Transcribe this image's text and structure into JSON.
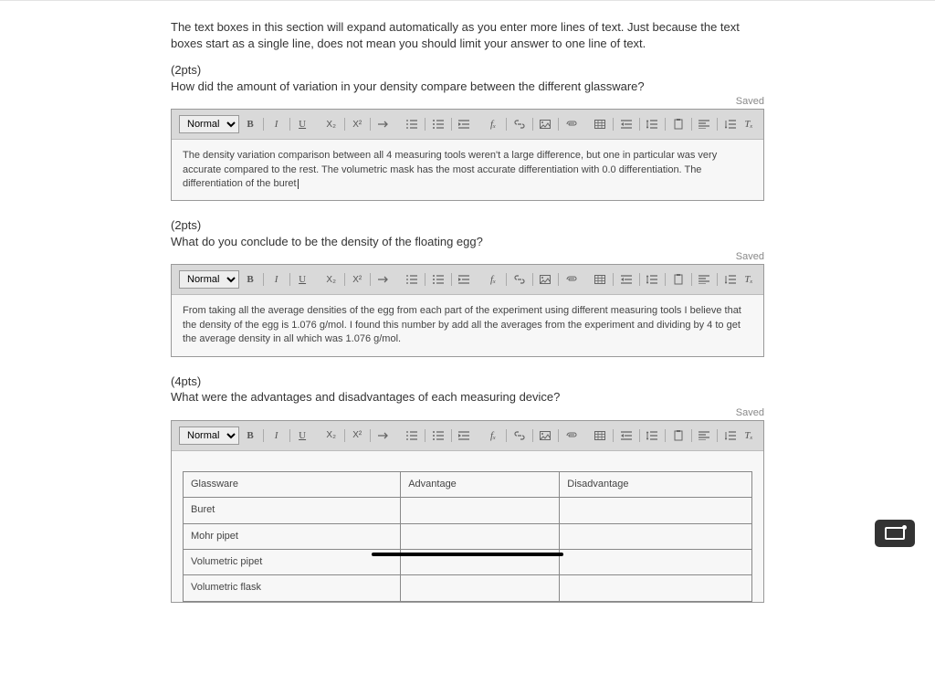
{
  "intro": "The text boxes in this section will expand automatically as you enter more lines of text. Just because the text boxes start as a single line, does not mean you should limit your answer to one line of text.",
  "saved_label": "Saved",
  "toolbar": {
    "style": "Normal",
    "bold": "B",
    "italic": "I",
    "underline": "U",
    "sub": "X₂",
    "sup": "X²",
    "fx": "fₓ",
    "clear": "Tₓ"
  },
  "questions": [
    {
      "pts": "(2pts)",
      "prompt": "How did the amount of variation in your density compare between the different glassware?",
      "answer": "The density variation comparison between all 4 measuring tools weren't a large difference, but one in particular was very accurate compared to the rest. The volumetric mask has the most accurate differentiation with 0.0 differentiation.   The differentiation of the buret",
      "has_caret": true
    },
    {
      "pts": "(2pts)",
      "prompt": "What do you conclude to be the density of the floating egg?",
      "answer": "From taking all the average densities of the egg from each part of the experiment using different measuring tools I believe that the density of the egg is 1.076 g/mol. I found this number by add all the averages from the experiment and dividing by 4 to get the average density in all which was 1.076 g/mol.",
      "has_caret": false
    },
    {
      "pts": "(4pts)",
      "prompt": "What were the advantages and disadvantages of each measuring device?",
      "answer": "",
      "has_table": true
    }
  ],
  "table": {
    "headers": [
      "Glassware",
      "Advantage",
      "Disadvantage"
    ],
    "rows": [
      [
        "Buret",
        "",
        ""
      ],
      [
        "Mohr pipet",
        "",
        ""
      ],
      [
        "Volumetric pipet",
        "",
        ""
      ],
      [
        "Volumetric flask",
        "",
        ""
      ]
    ]
  }
}
